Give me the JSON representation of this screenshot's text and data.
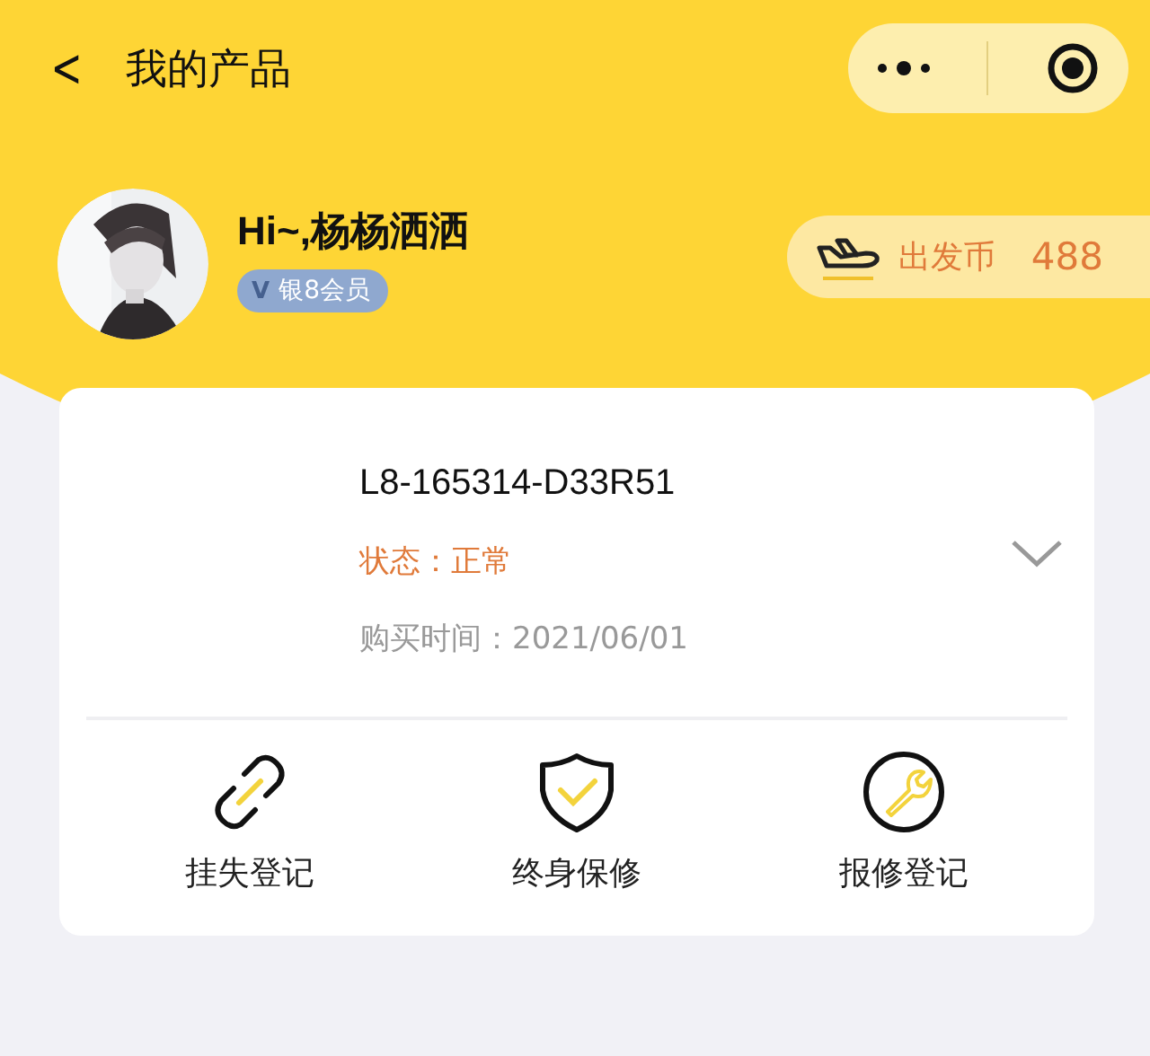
{
  "nav": {
    "back": "<",
    "title": "我的产品"
  },
  "user": {
    "greeting": "Hi~,杨杨洒洒",
    "badge_mark": "V",
    "badge": "银8会员"
  },
  "coins": {
    "label": "出发币",
    "value": "488"
  },
  "product": {
    "serial": "L8-165314-D33R51",
    "status": "状态：正常",
    "purchase": "购买时间：2021/06/01",
    "expanded": false
  },
  "actions": [
    {
      "kind": "link",
      "label": "挂失登记"
    },
    {
      "kind": "shield",
      "label": "终身保修"
    },
    {
      "kind": "wrench",
      "label": "报修登记"
    }
  ]
}
